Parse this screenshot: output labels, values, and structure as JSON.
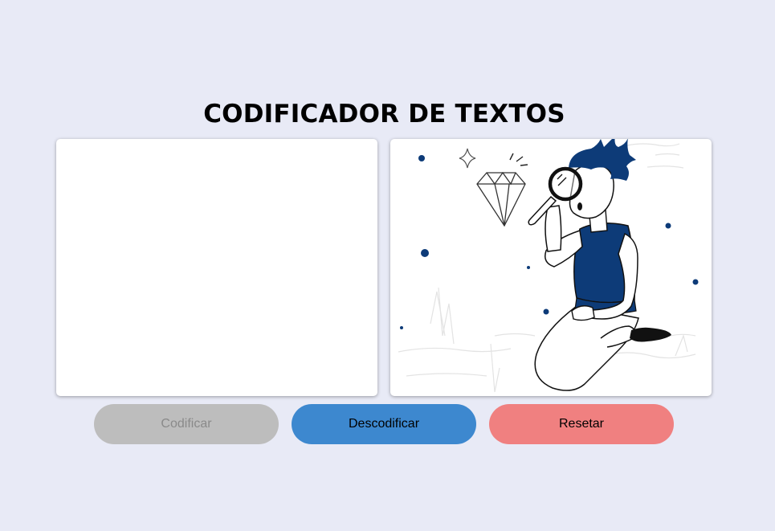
{
  "header": {
    "title": "CODIFICADOR DE TEXTOS"
  },
  "editor": {
    "value": "",
    "placeholder": ""
  },
  "illustration": {
    "icon": "person-with-magnifier-and-diamond",
    "accent_color": "#0d3b78"
  },
  "buttons": {
    "encode_label": "Codificar",
    "decode_label": "Descodificar",
    "reset_label": "Resetar"
  },
  "colors": {
    "background": "#e8eaf6",
    "encode": "#bdbdbd",
    "decode": "#3d88cf",
    "reset": "#f08080"
  }
}
